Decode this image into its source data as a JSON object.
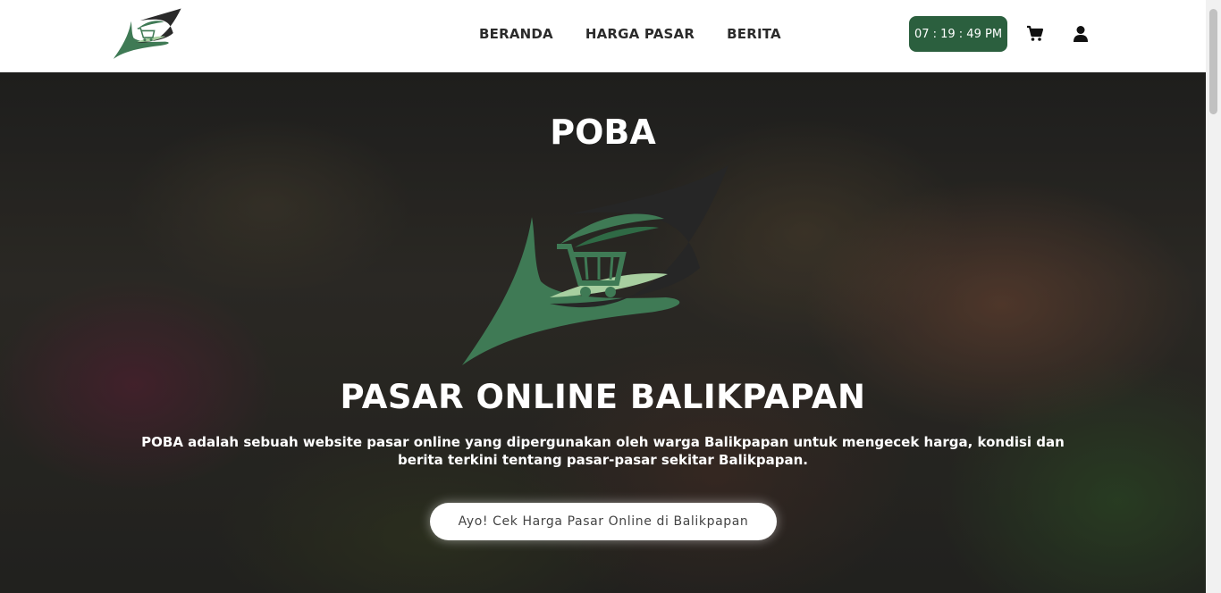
{
  "nav": {
    "links": [
      "BERANDA",
      "HARGA PASAR",
      "BERITA"
    ],
    "clock": "07 : 19 : 49 PM",
    "icons": [
      "logo-icon",
      "cart-icon",
      "user-icon"
    ]
  },
  "hero": {
    "title": "POBA",
    "heading": "PASAR ONLINE BALIKPAPAN",
    "description": "POBA adalah sebuah website pasar online yang dipergunakan oleh warga Balikpapan untuk mengecek harga, kondisi dan berita terkini tentang pasar-pasar sekitar Balikpapan.",
    "cta_label": "Ayo! Cek Harga Pasar Online di Balikpapan"
  },
  "colors": {
    "brand_green": "#2b5f3e",
    "logo_green": "#3f7a55",
    "logo_light": "#a8cfa0",
    "logo_dark": "#2a2a2a"
  }
}
